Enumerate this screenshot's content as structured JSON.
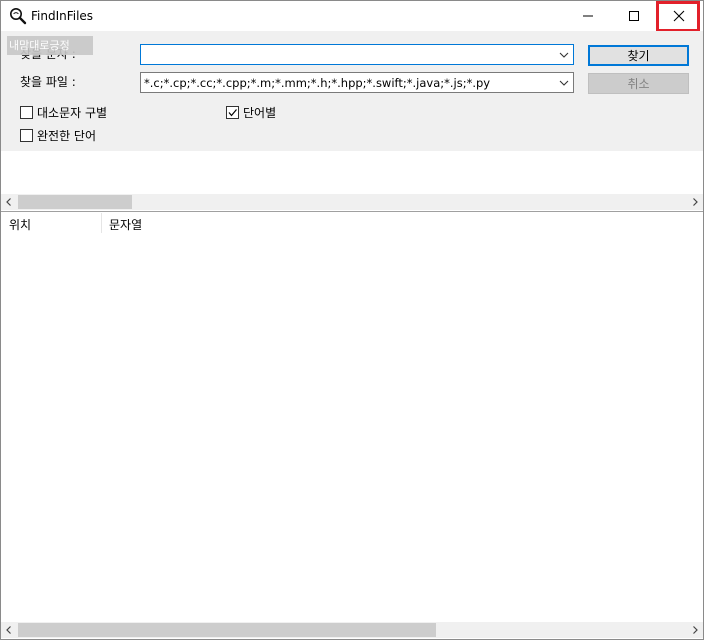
{
  "window": {
    "title": "FindInFiles"
  },
  "form": {
    "find_label": "찾을 문자 :",
    "find_value": "",
    "files_label": "찾을 파일 :",
    "files_value": "*.c;*.cp;*.cc;*.cpp;*.m;*.mm;*.h;*.hpp;*.swift;*.java;*.js;*.py",
    "find_button": "찾기",
    "cancel_button": "취소",
    "tooltip": "내맘대로긍정"
  },
  "options": {
    "match_case": {
      "label": "대소문자 구별",
      "checked": false
    },
    "whole_word": {
      "label": "완전한 단어",
      "checked": false
    },
    "word_unit": {
      "label": "단어별",
      "checked": true
    }
  },
  "results": {
    "columns": [
      "위치",
      "문자열"
    ],
    "rows": []
  },
  "icons": {
    "app": "magnifier-icon",
    "minimize": "minimize-icon",
    "maximize": "maximize-icon",
    "close": "close-icon"
  },
  "colors": {
    "close_highlight": "#e2202a",
    "focus_border": "#0078d7"
  }
}
